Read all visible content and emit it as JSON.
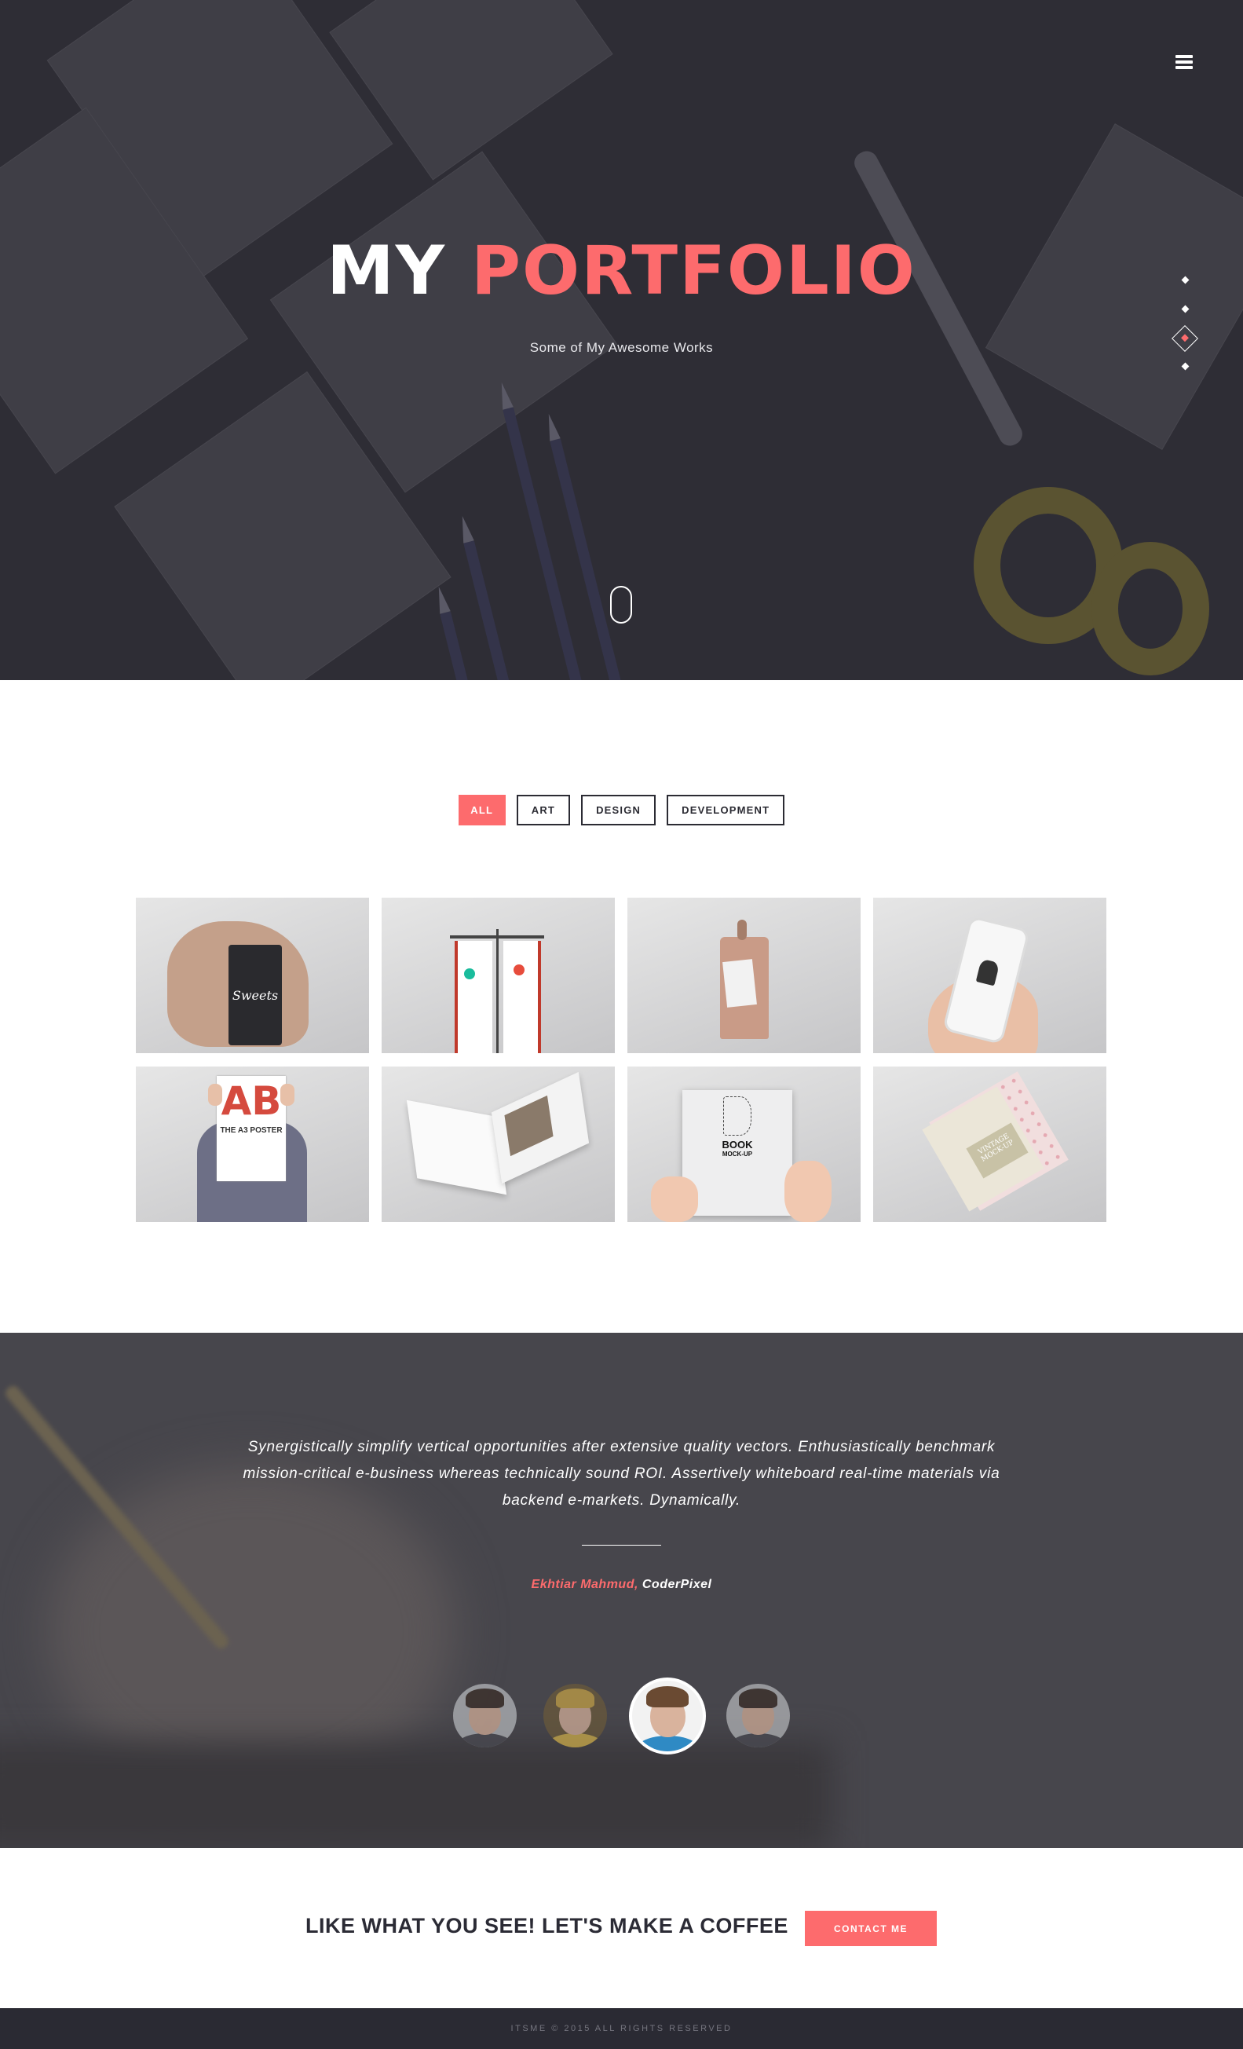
{
  "hero": {
    "title_part1": "MY",
    "title_part2": "PORTFOLIO",
    "subtitle": "Some of My Awesome Works",
    "menu_icon": "hamburger-icon",
    "nav_dots": 4,
    "active_dot": 3
  },
  "filters": [
    "ALL",
    "ART",
    "DESIGN",
    "DEVELOPMENT"
  ],
  "active_filter": "ALL",
  "portfolio": {
    "items": [
      {
        "subject": "Sweets cup",
        "label": "Sweets"
      },
      {
        "subject": "roll-up banners"
      },
      {
        "subject": "gift bag with tag"
      },
      {
        "subject": "phone in hand"
      },
      {
        "subject": "A3 poster",
        "poster_letters": "AB",
        "poster_title": "THE A3 POSTER"
      },
      {
        "subject": "open magazine"
      },
      {
        "subject": "book mock-up",
        "label1": "BOOK",
        "label2": "MOCK-UP"
      },
      {
        "subject": "envelope vintage",
        "label1": "VINTAGE",
        "label2": "MOCK-UP"
      }
    ]
  },
  "testimonial": {
    "quote": "Synergistically simplify vertical opportunities after extensive quality vectors. Enthusiastically benchmark mission-critical e-business whereas technically sound ROI. Assertively whiteboard real-time materials via backend e-markets. Dynamically.",
    "author_name": "Ekhtiar Mahmud,",
    "author_company": "CoderPixel",
    "active_avatar": 3
  },
  "cta": {
    "text": "LIKE WHAT YOU SEE! LET'S MAKE A COFFEE",
    "button": "CONTACT ME"
  },
  "footer": {
    "copyright": "ITSME © 2015 ALL RIGHTS RESERVED"
  },
  "colors": {
    "accent": "#fd6b6d",
    "dark": "#2e2d35",
    "text_dark": "#2b2b35"
  }
}
